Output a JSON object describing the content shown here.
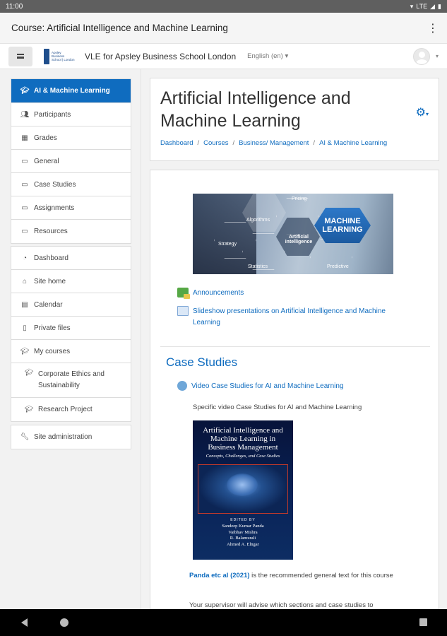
{
  "status_bar": {
    "time": "11:00",
    "network": "LTE"
  },
  "app_bar": {
    "title": "Course: Artificial Intelligence and Machine Learning",
    "more_icon": "more-vert-icon"
  },
  "navbar": {
    "logo_text": [
      "Apsley",
      "Business",
      "School | London"
    ],
    "site_name": "VLE for Apsley Business School London",
    "language": "English (en) ▾"
  },
  "drawer": {
    "course_items": [
      {
        "label": "AI & Machine Learning",
        "icon": "graduation-cap-icon",
        "active": true
      },
      {
        "label": "Participants",
        "icon": "users-icon"
      },
      {
        "label": "Grades",
        "icon": "table-icon"
      },
      {
        "label": "General",
        "icon": "folder-icon"
      },
      {
        "label": "Case Studies",
        "icon": "folder-icon"
      },
      {
        "label": "Assignments",
        "icon": "folder-icon"
      },
      {
        "label": "Resources",
        "icon": "folder-icon"
      }
    ],
    "site_items": [
      {
        "label": "Dashboard",
        "icon": "dashboard-icon"
      },
      {
        "label": "Site home",
        "icon": "home-icon"
      },
      {
        "label": "Calendar",
        "icon": "calendar-icon"
      },
      {
        "label": "Private files",
        "icon": "file-icon"
      },
      {
        "label": "My courses",
        "icon": "graduation-cap-icon"
      },
      {
        "label": "Corporate Ethics and Sustainability",
        "icon": "graduation-cap-icon"
      },
      {
        "label": "Research Project",
        "icon": "graduation-cap-icon"
      }
    ],
    "admin_items": [
      {
        "label": "Site administration",
        "icon": "wrench-icon"
      }
    ]
  },
  "page_header": {
    "title": "Artificial Intelligence and Machine Learning",
    "breadcrumb": [
      "Dashboard",
      "Courses",
      "Business/ Management",
      "AI & Machine Learning"
    ]
  },
  "course": {
    "banner_labels": {
      "badge": "MACHINE LEARNING",
      "hexes": [
        "Algorithms",
        "Artificial intelligence",
        "Statistics",
        "Strategy",
        "Pricing",
        "Predictive"
      ]
    },
    "activities": [
      {
        "label": "Announcements",
        "icon": "forum-icon"
      },
      {
        "label": "Slideshow presentations on Artificial Intelligence and Machine Learning",
        "icon": "file-icon"
      }
    ],
    "case_studies": {
      "title": "Case Studies",
      "activity": {
        "label": "Video Case Studies for AI and Machine Learning",
        "icon": "url-icon"
      },
      "summary": "Specific video Case Studies for AI and Machine Learning",
      "book": {
        "title": "Artificial Intelligence and Machine Learning in Business Management",
        "subtitle": "Concepts, Challenges, and Case Studies",
        "edited_by": "EDITED BY",
        "authors": [
          "Sandeep Kumar Panda",
          "Vaibhav Mishra",
          "R. Balamurali",
          "Ahmed A. Elngar"
        ]
      },
      "recommendation_link": "Panda etc al (2021)",
      "recommendation_rest": " is the recommended general text for this course",
      "advice": "Your supervisor will advise which sections and case studies to"
    }
  }
}
